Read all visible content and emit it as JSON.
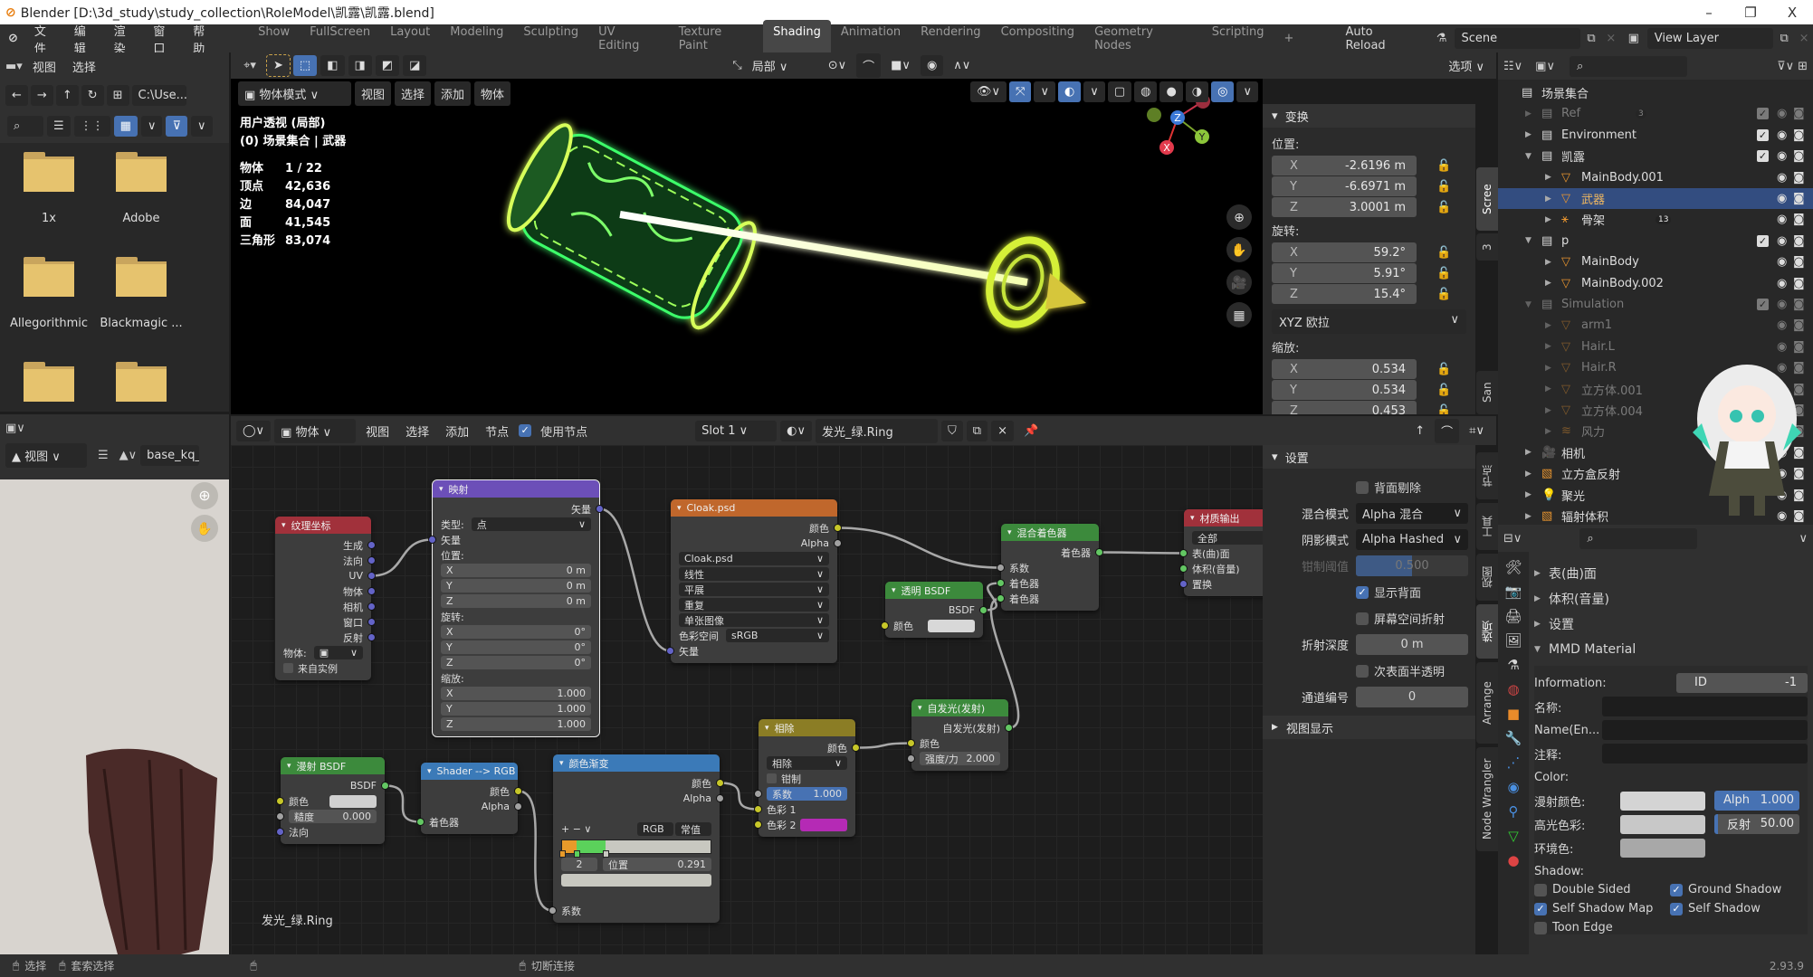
{
  "window": {
    "title": "Blender [D:\\3d_study\\study_collection\\RoleModel\\凯露\\凯露.blend]",
    "minimize": "–",
    "maximize": "❐",
    "close": "X"
  },
  "topbar": {
    "menus": [
      "文件",
      "编辑",
      "渲染",
      "窗口",
      "帮助"
    ],
    "workspaces": [
      "Show",
      "FullScreen",
      "Layout",
      "Modeling",
      "Sculpting",
      "UV Editing",
      "Texture Paint",
      "Shading",
      "Animation",
      "Rendering",
      "Compositing",
      "Geometry Nodes",
      "Scripting"
    ],
    "active_workspace": "Shading",
    "add_tab": "+",
    "auto_reload": "Auto Reload",
    "scene": "Scene",
    "view_layer": "View Layer"
  },
  "tool_header": {
    "file_menus": [
      "视图",
      "选择"
    ],
    "transform_orientation": "局部",
    "options": "选项"
  },
  "file_browser": {
    "path": "C:\\Use...",
    "folders": [
      "1x",
      "Adobe",
      "Allegorithmic",
      "Blackmagic ...",
      "",
      ""
    ]
  },
  "viewport": {
    "mode": "物体模式",
    "menus": [
      "视图",
      "选择",
      "添加",
      "物体"
    ],
    "view_name": "用户透视 (局部)",
    "collection_line": "(0) 场景集合 | 武器",
    "stats": [
      {
        "label": "物体",
        "value": "1 / 22"
      },
      {
        "label": "顶点",
        "value": "42,636"
      },
      {
        "label": "边",
        "value": "84,047"
      },
      {
        "label": "面",
        "value": "41,545"
      },
      {
        "label": "三角形",
        "value": "83,074"
      }
    ],
    "gizmo_axes": [
      "X",
      "Y",
      "Z"
    ],
    "glow_color": "#3cff6a"
  },
  "transform_panel": {
    "title": "变换",
    "location_label": "位置:",
    "location": [
      {
        "axis": "X",
        "value": "-2.6196 m"
      },
      {
        "axis": "Y",
        "value": "-6.6971 m"
      },
      {
        "axis": "Z",
        "value": "3.0001 m"
      }
    ],
    "rotation_label": "旋转:",
    "rotation": [
      {
        "axis": "X",
        "value": "59.2°"
      },
      {
        "axis": "Y",
        "value": "5.91°"
      },
      {
        "axis": "Z",
        "value": "15.4°"
      }
    ],
    "rotation_mode": "XYZ 欧拉",
    "scale_label": "缩放:",
    "scale": [
      {
        "axis": "X",
        "value": "0.534"
      },
      {
        "axis": "Y",
        "value": "0.534"
      },
      {
        "axis": "Z",
        "value": "0.453"
      }
    ],
    "tabs": [
      "Scree",
      "3",
      "San"
    ]
  },
  "outliner": {
    "rows": [
      {
        "name": "场景集合",
        "level": 0,
        "icon": "collection",
        "expanded": true
      },
      {
        "name": "Ref",
        "level": 1,
        "icon": "collection",
        "dim": true,
        "check": true,
        "badge": "3"
      },
      {
        "name": "Environment",
        "level": 1,
        "icon": "collection",
        "check": true
      },
      {
        "name": "凯露",
        "level": 1,
        "icon": "collection",
        "check": true,
        "expanded": true
      },
      {
        "name": "MainBody.001",
        "level": 2,
        "icon": "mesh"
      },
      {
        "name": "武器",
        "level": 2,
        "icon": "mesh",
        "selected": true
      },
      {
        "name": "骨架",
        "level": 2,
        "icon": "armature",
        "badge": "13"
      },
      {
        "name": "p",
        "level": 1,
        "icon": "collection",
        "check": true,
        "expanded": true
      },
      {
        "name": "MainBody",
        "level": 2,
        "icon": "mesh"
      },
      {
        "name": "MainBody.002",
        "level": 2,
        "icon": "mesh"
      },
      {
        "name": "Simulation",
        "level": 1,
        "icon": "collection",
        "dim": true,
        "check": true,
        "expanded": true
      },
      {
        "name": "arm1",
        "level": 2,
        "icon": "mesh",
        "dim": true
      },
      {
        "name": "Hair.L",
        "level": 2,
        "icon": "mesh",
        "dim": true
      },
      {
        "name": "Hair.R",
        "level": 2,
        "icon": "mesh",
        "dim": true
      },
      {
        "name": "立方体.001",
        "level": 2,
        "icon": "mesh",
        "dim": true
      },
      {
        "name": "立方体.004",
        "level": 2,
        "icon": "mesh",
        "dim": true
      },
      {
        "name": "风力",
        "level": 2,
        "icon": "force",
        "dim": true
      },
      {
        "name": "相机",
        "level": 1,
        "icon": "camera"
      },
      {
        "name": "立方盒反射",
        "level": 1,
        "icon": "probe"
      },
      {
        "name": "聚光",
        "level": 1,
        "icon": "light"
      },
      {
        "name": "辐射体积",
        "level": 1,
        "icon": "probe"
      }
    ],
    "selected_color": "#334d80"
  },
  "image_editor": {
    "view_menu": "视图",
    "image_name": "base_kq_"
  },
  "node_editor": {
    "object_type": "物体",
    "menus": [
      "视图",
      "选择",
      "添加",
      "节点"
    ],
    "use_nodes_label": "使用节点",
    "use_nodes": true,
    "slot": "Slot 1",
    "material": "发光_绿.Ring",
    "material_label": "发光_绿.Ring",
    "nodes": [
      {
        "id": "texcoord",
        "title": "纹理坐标",
        "color": "#a1313b",
        "rows": [
          {
            "t": "out",
            "text": "生成",
            "s": "#6363c7"
          },
          {
            "t": "out",
            "text": "法向",
            "s": "#6363c7"
          },
          {
            "t": "out",
            "text": "UV",
            "s": "#6363c7"
          },
          {
            "t": "out",
            "text": "物体",
            "s": "#6363c7"
          },
          {
            "t": "out",
            "text": "相机",
            "s": "#6363c7"
          },
          {
            "t": "out",
            "text": "窗口",
            "s": "#6363c7"
          },
          {
            "t": "out",
            "text": "反射",
            "s": "#6363c7"
          },
          {
            "t": "select",
            "label": "物体:",
            "text": "▣"
          },
          {
            "t": "check",
            "text": "来自实例"
          }
        ]
      },
      {
        "id": "mapping",
        "title": "映射",
        "color": "#6c4fb8",
        "rows": [
          {
            "t": "out",
            "text": "矢量",
            "s": "#6363c7"
          },
          {
            "t": "select",
            "label": "类型:",
            "text": "点"
          },
          {
            "t": "in",
            "text": "矢量",
            "s": "#6363c7"
          },
          {
            "t": "label",
            "text": "位置:"
          },
          {
            "t": "field",
            "text": "X",
            "value": "0 m"
          },
          {
            "t": "field",
            "text": "Y",
            "value": "0 m"
          },
          {
            "t": "field",
            "text": "Z",
            "value": "0 m"
          },
          {
            "t": "label",
            "text": "旋转:"
          },
          {
            "t": "field",
            "text": "X",
            "value": "0°"
          },
          {
            "t": "field",
            "text": "Y",
            "value": "0°"
          },
          {
            "t": "field",
            "text": "Z",
            "value": "0°"
          },
          {
            "t": "label",
            "text": "缩放:"
          },
          {
            "t": "field",
            "text": "X",
            "value": "1.000"
          },
          {
            "t": "field",
            "text": "Y",
            "value": "1.000"
          },
          {
            "t": "field",
            "text": "Z",
            "value": "1.000"
          }
        ]
      },
      {
        "id": "image",
        "title": "Cloak.psd",
        "color": "#c0672c",
        "rows": [
          {
            "t": "out",
            "text": "颜色",
            "s": "#c7c729"
          },
          {
            "t": "out",
            "text": "Alpha",
            "s": "#a1a1a1"
          },
          {
            "t": "select",
            "text": "Cloak.psd"
          },
          {
            "t": "select",
            "text": "线性"
          },
          {
            "t": "select",
            "text": "平展"
          },
          {
            "t": "select",
            "text": "重复"
          },
          {
            "t": "select",
            "text": "单张图像"
          },
          {
            "t": "select",
            "label": "色彩空间",
            "text": "sRGB"
          },
          {
            "t": "in",
            "text": "矢量",
            "s": "#6363c7"
          }
        ]
      },
      {
        "id": "transparent",
        "title": "透明 BSDF",
        "color": "#3c8a3c",
        "rows": [
          {
            "t": "out",
            "text": "BSDF",
            "s": "#63c763"
          },
          {
            "t": "swatch",
            "text": "颜色",
            "s": "#c7c729",
            "color": "#d8d8d8"
          }
        ]
      },
      {
        "id": "mix",
        "title": "混合着色器",
        "color": "#3c8a3c",
        "rows": [
          {
            "t": "out",
            "text": "着色器",
            "s": "#63c763"
          },
          {
            "t": "in",
            "text": "系数",
            "s": "#a1a1a1"
          },
          {
            "t": "in",
            "text": "着色器",
            "s": "#63c763"
          },
          {
            "t": "in",
            "text": "着色器",
            "s": "#63c763"
          }
        ]
      },
      {
        "id": "output",
        "title": "材质输出",
        "color": "#a1313b",
        "rows": [
          {
            "t": "select",
            "text": "全部"
          },
          {
            "t": "in",
            "text": "表(曲)面",
            "s": "#63c763"
          },
          {
            "t": "in",
            "text": "体积(音量)",
            "s": "#63c763"
          },
          {
            "t": "in",
            "text": "置换",
            "s": "#6363c7"
          }
        ]
      },
      {
        "id": "emission",
        "title": "自发光(发射)",
        "color": "#3c8a3c",
        "rows": [
          {
            "t": "out",
            "text": "自发光(发射)",
            "s": "#63c763"
          },
          {
            "t": "in",
            "text": "颜色",
            "s": "#c7c729"
          },
          {
            "t": "field",
            "text": "强度/力",
            "value": "2.000",
            "s": "#a1a1a1"
          }
        ]
      },
      {
        "id": "divide",
        "title": "相除",
        "color": "#8b7d25",
        "rows": [
          {
            "t": "out",
            "text": "颜色",
            "s": "#c7c729"
          },
          {
            "t": "select",
            "text": "相除"
          },
          {
            "t": "check",
            "text": "钳制"
          },
          {
            "t": "field",
            "text": "系数",
            "value": "1.000",
            "s": "#a1a1a1",
            "blue": true
          },
          {
            "t": "in",
            "text": "色彩 1",
            "s": "#c7c729"
          },
          {
            "t": "swatch",
            "text": "色彩 2",
            "s": "#c7c729",
            "color": "#b52ab5"
          }
        ]
      },
      {
        "id": "diffuse",
        "title": "漫射 BSDF",
        "color": "#3c8a3c",
        "rows": [
          {
            "t": "out",
            "text": "BSDF",
            "s": "#63c763"
          },
          {
            "t": "swatch",
            "text": "颜色",
            "s": "#c7c729",
            "color": "#d0d0d0"
          },
          {
            "t": "field",
            "text": "糙度",
            "value": "0.000",
            "s": "#a1a1a1"
          },
          {
            "t": "in",
            "text": "法向",
            "s": "#6363c7"
          }
        ]
      },
      {
        "id": "shader2rgb",
        "title": "Shader --> RGB",
        "color": "#3b7ab8",
        "rows": [
          {
            "t": "out",
            "text": "颜色",
            "s": "#c7c729"
          },
          {
            "t": "out",
            "text": "Alpha",
            "s": "#a1a1a1"
          },
          {
            "t": "in",
            "text": "着色器",
            "s": "#63c763"
          }
        ]
      },
      {
        "id": "ramp",
        "title": "颜色渐变",
        "color": "#3b7ab8",
        "rows": [
          {
            "t": "out",
            "text": "颜色",
            "s": "#c7c729"
          },
          {
            "t": "out",
            "text": "Alpha",
            "s": "#a1a1a1"
          },
          {
            "t": "blank"
          },
          {
            "t": "rampctl",
            "text": "+  −  ∨",
            "mode": "RGB",
            "interp": "常值"
          },
          {
            "t": "rampbar",
            "stops": [
              {
                "pos": 0.0,
                "color": "#e89a2a"
              },
              {
                "pos": 0.1,
                "color": "#5bd15b"
              },
              {
                "pos": 0.291,
                "color": "#c8c8c0"
              }
            ]
          },
          {
            "t": "rampidx",
            "text": "2",
            "label": "位置",
            "value": "0.291"
          },
          {
            "t": "rampcolor",
            "color": "#c8c8c0"
          },
          {
            "t": "blank"
          },
          {
            "t": "in",
            "text": "系数",
            "s": "#a1a1a1"
          }
        ]
      }
    ],
    "links": [
      {
        "from": [
          "texcoord",
          2
        ],
        "to": [
          "mapping",
          2
        ]
      },
      {
        "from": [
          "mapping",
          0
        ],
        "to": [
          "image",
          8
        ]
      },
      {
        "from": [
          "image",
          0
        ],
        "to": [
          "mix",
          1
        ]
      },
      {
        "from": [
          "transparent",
          0
        ],
        "to": [
          "mix",
          2
        ]
      },
      {
        "from": [
          "emission",
          0
        ],
        "to": [
          "mix",
          3
        ]
      },
      {
        "from": [
          "mix",
          0
        ],
        "to": [
          "output",
          1
        ]
      },
      {
        "from": [
          "divide",
          0
        ],
        "to": [
          "emission",
          1
        ]
      },
      {
        "from": [
          "diffuse",
          0
        ],
        "to": [
          "shader2rgb",
          2
        ]
      },
      {
        "from": [
          "shader2rgb",
          0
        ],
        "to": [
          "ramp",
          8
        ]
      },
      {
        "from": [
          "ramp",
          0
        ],
        "to": [
          "divide",
          4
        ]
      }
    ]
  },
  "material_settings": {
    "title": "设置",
    "backface_culling": {
      "label": "背面剔除",
      "checked": false
    },
    "blend_mode": {
      "label": "混合模式",
      "value": "Alpha 混合"
    },
    "shadow_mode": {
      "label": "阴影模式",
      "value": "Alpha Hashed"
    },
    "clip_threshold": {
      "label": "钳制阈值",
      "value": "0.500"
    },
    "show_backface": {
      "label": "显示背面",
      "checked": true
    },
    "ss_refraction": {
      "label": "屏幕空间折射",
      "checked": false
    },
    "refraction_depth": {
      "label": "折射深度",
      "value": "0 m"
    },
    "sss_translucency": {
      "label": "次表面半透明",
      "checked": false
    },
    "pass_index": {
      "label": "通道编号",
      "value": "0"
    },
    "viewport_display": "视图显示",
    "tabs": [
      "节点",
      "工具",
      "视图",
      "选项",
      "Arrange",
      "Node Wrangler"
    ]
  },
  "properties": {
    "panels": [
      "表(曲)面",
      "体积(音量)",
      "设置",
      "MMD Material"
    ],
    "information_label": "Information:",
    "id_label": "ID",
    "id_value": "-1",
    "name_label": "名称:",
    "name_en_label": "Name(En...",
    "comment_label": "注释:",
    "color_label": "Color:",
    "diffuse_label": "漫射颜色:",
    "specular_label": "高光色彩:",
    "ambient_label": "环境色:",
    "alpha_label": "Alph",
    "alpha_value": "1.000",
    "reflect_label": "反射",
    "reflect_value": "50.00",
    "shadow_label": "Shadow:",
    "checks": [
      {
        "label": "Double Sided",
        "checked": false
      },
      {
        "label": "Ground Shadow",
        "checked": true
      },
      {
        "label": "Self Shadow Map",
        "checked": true
      },
      {
        "label": "Self Shadow",
        "checked": true
      },
      {
        "label": "Toon Edge",
        "checked": false
      }
    ]
  },
  "statusbar": {
    "select": "选择",
    "lasso": "套索选择",
    "cut_links": "切断连接",
    "version": "2.93.9"
  }
}
